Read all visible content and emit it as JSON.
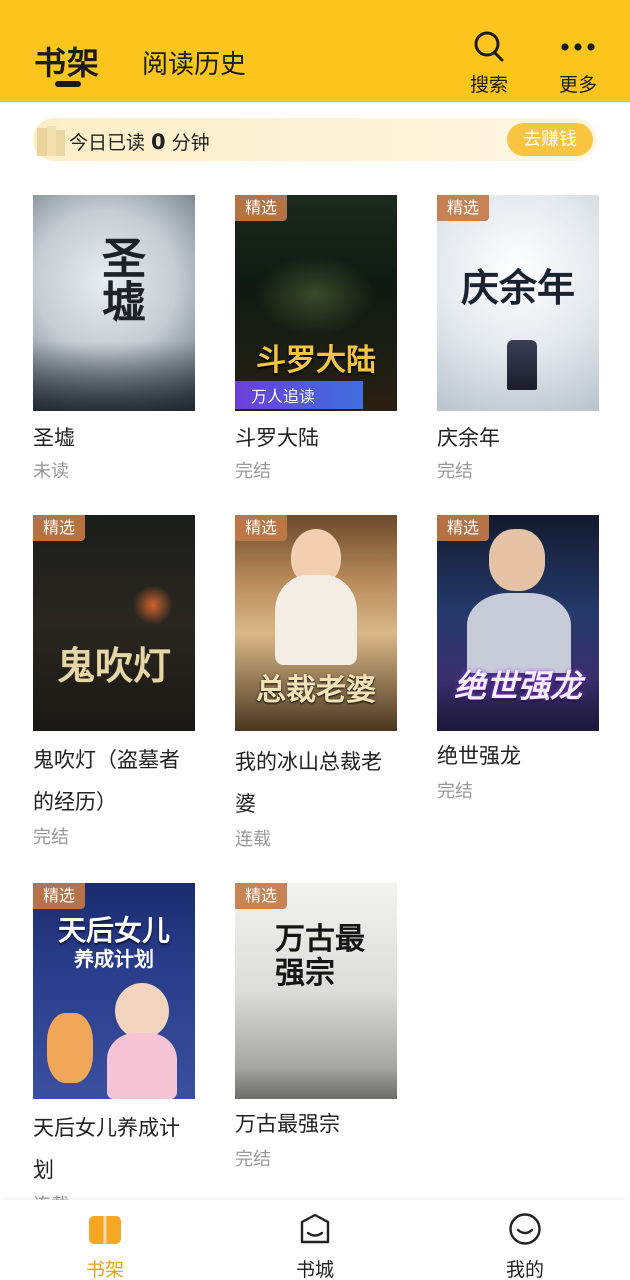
{
  "header": {
    "tab_shelf": "书架",
    "tab_history": "阅读历史",
    "search_label": "搜索",
    "more_label": "更多",
    "bg_color": "#fcc51e"
  },
  "banner": {
    "prefix": "今日已读",
    "minutes": "0",
    "suffix": "分钟",
    "earn_label": "去赚钱"
  },
  "books": [
    {
      "title": "圣墟",
      "status": "未读",
      "badge": "",
      "cover_text": "圣墟"
    },
    {
      "title": "斗罗大陆",
      "status": "完结",
      "badge": "精选",
      "cover_text": "斗罗大陆",
      "cover_tag": "万人追读"
    },
    {
      "title": "庆余年",
      "status": "完结",
      "badge": "精选",
      "cover_text": "庆余年"
    },
    {
      "title_line1": "鬼吹灯（盗墓者",
      "title_line2": "的经历）",
      "status": "完结",
      "badge": "精选",
      "cover_text": "鬼吹灯"
    },
    {
      "title_line1": "我的冰山总裁老",
      "title_line2": "婆",
      "status": "连载",
      "badge": "精选",
      "cover_text": "总裁老婆"
    },
    {
      "title": "绝世强龙",
      "status": "完结",
      "badge": "精选",
      "cover_text": "绝世强龙"
    },
    {
      "title_line1": "天后女儿养成计",
      "title_line2": "划",
      "status": "连载",
      "badge": "精选",
      "cover_text": "天后女儿",
      "cover_text2": "养成计划"
    },
    {
      "title": "万古最强宗",
      "status": "完结",
      "badge": "精选",
      "cover_text": "万古最强宗"
    }
  ],
  "bottom_nav": {
    "items": [
      {
        "label": "书架",
        "icon": "bookshelf-icon",
        "active": true
      },
      {
        "label": "书城",
        "icon": "bookstore-icon",
        "active": false
      },
      {
        "label": "我的",
        "icon": "profile-icon",
        "active": false
      }
    ],
    "active_color": "#e8a317"
  }
}
